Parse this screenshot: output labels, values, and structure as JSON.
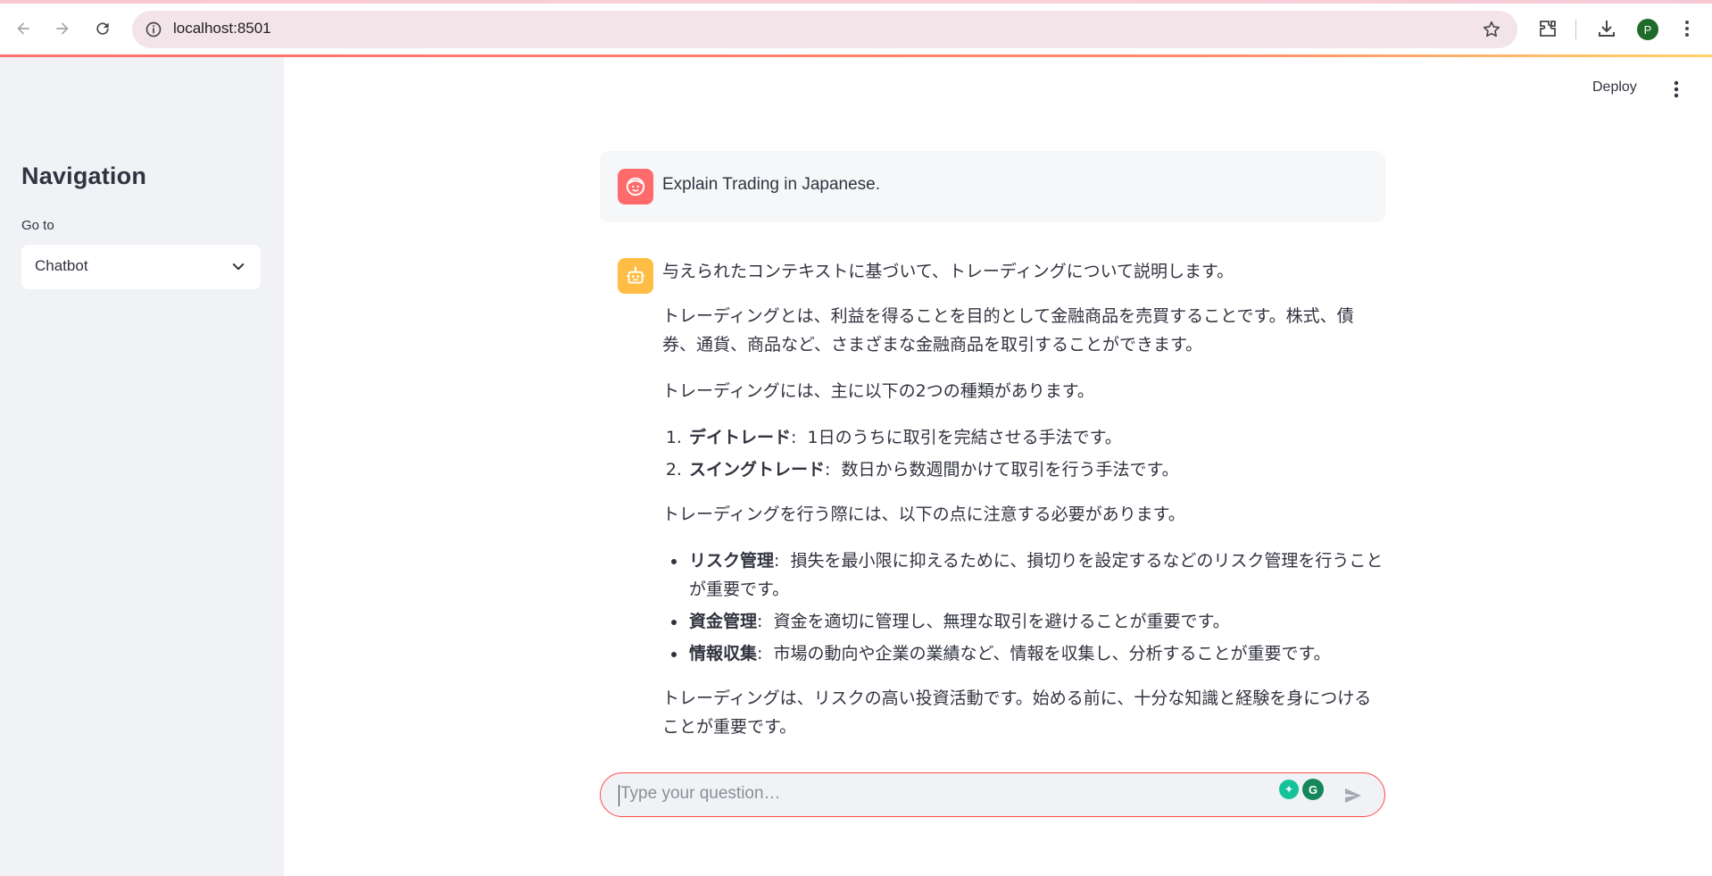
{
  "browser": {
    "url": "localhost:8501",
    "profile_initial": "P"
  },
  "sidebar": {
    "title": "Navigation",
    "select_label": "Go to",
    "select_value": "Chatbot"
  },
  "header": {
    "deploy_label": "Deploy"
  },
  "chat": {
    "user_message": "Explain Trading in Japanese.",
    "assistant": {
      "intro": "与えられたコンテキストに基づいて、トレーディングについて説明します。",
      "p1": "トレーディングとは、利益を得ることを目的として金融商品を売買することです。株式、債券、通貨、商品など、さまざまな金融商品を取引することができます。",
      "p2": "トレーディングには、主に以下の2つの種類があります。",
      "types": [
        {
          "term": "デイトレード",
          "desc": "1日のうちに取引を完結させる手法です。"
        },
        {
          "term": "スイングトレード",
          "desc": "数日から数週間かけて取引を行う手法です。"
        }
      ],
      "p3": "トレーディングを行う際には、以下の点に注意する必要があります。",
      "points": [
        {
          "term": "リスク管理",
          "desc": "損失を最小限に抑えるために、損切りを設定するなどのリスク管理を行うことが重要です。"
        },
        {
          "term": "資金管理",
          "desc": "資金を適切に管理し、無理な取引を避けることが重要です。"
        },
        {
          "term": "情報収集",
          "desc": "市場の動向や企業の業績など、情報を収集し、分析することが重要です。"
        }
      ],
      "conclusion": "トレーディングは、リスクの高い投資活動です。始める前に、十分な知識と経験を身につけることが重要です。"
    }
  },
  "input": {
    "placeholder": "Type your question…"
  },
  "icons": {
    "back": "arrow-left-icon",
    "forward": "arrow-right-icon",
    "reload": "reload-icon",
    "site_info": "site-info-icon",
    "bookmark": "star-icon",
    "extensions": "puzzle-icon",
    "downloads": "download-icon",
    "browser_menu": "kebab-menu-icon",
    "user_avatar": "face-icon",
    "assistant_avatar": "robot-icon",
    "send": "send-icon"
  },
  "colors": {
    "accent": "#ff4b4b",
    "sidebar_bg": "#f0f2f6",
    "user_avatar": "#ff6b6b",
    "assistant_avatar": "#ffbd45",
    "profile": "#1e6b2a"
  }
}
